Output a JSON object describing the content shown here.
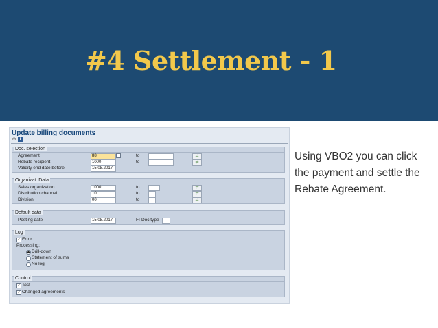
{
  "slide": {
    "title": "#4 Settlement - 1",
    "description": "Using VBO2 you can click the payment and settle the Rebate Agreement."
  },
  "screen": {
    "title": "Update billing documents",
    "toolbar": {
      "icons": [
        "execute-icon",
        "info-icon"
      ],
      "info_glyph": "i"
    },
    "to_label": "to",
    "doc_selection": {
      "heading": "Doc. selection",
      "rows": [
        {
          "label": "Agreement",
          "from": "88"
        },
        {
          "label": "Rebate recipient",
          "from": "1000"
        },
        {
          "label": "Validity end date before",
          "from": "15.08.2017"
        }
      ]
    },
    "org_data": {
      "heading": "Organizat. Data",
      "rows": [
        {
          "label": "Sales organization",
          "from": "1000"
        },
        {
          "label": "Distribution channel",
          "from": "10"
        },
        {
          "label": "Division",
          "from": "00"
        }
      ]
    },
    "default_data": {
      "heading": "Default data",
      "posting_label": "Posting date",
      "posting_value": "15.08.2017",
      "fi_label": "FI-Doc.type",
      "fi_value": ""
    },
    "log": {
      "heading": "Log",
      "error_label": "Error",
      "processing_label": "Processing:",
      "options": [
        {
          "label": "Drill-down",
          "selected": true
        },
        {
          "label": "Statement of sums",
          "selected": false
        },
        {
          "label": "No log",
          "selected": false
        }
      ]
    },
    "control": {
      "heading": "Control",
      "test_label": "Test",
      "changed_label": "Changed agreements"
    },
    "multi_button_glyph": "⇄",
    "check_glyph": "✓"
  }
}
